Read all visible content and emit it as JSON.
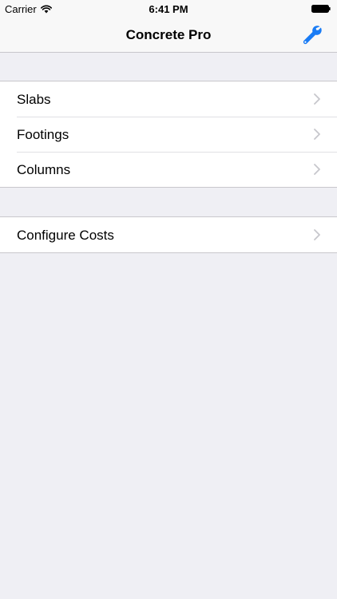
{
  "status_bar": {
    "carrier": "Carrier",
    "time": "6:41 PM",
    "wifi_icon": "wifi-icon",
    "battery_icon": "battery-icon"
  },
  "nav_bar": {
    "title": "Concrete Pro",
    "right_icon": "wrench-icon",
    "accent_color": "#1a7cf5"
  },
  "sections": [
    {
      "items": [
        {
          "label": "Slabs"
        },
        {
          "label": "Footings"
        },
        {
          "label": "Columns"
        }
      ]
    },
    {
      "items": [
        {
          "label": "Configure Costs"
        }
      ]
    }
  ],
  "colors": {
    "background": "#efeff4",
    "cell": "#ffffff",
    "separator": "#c8c7cc",
    "chevron": "#c7c7cc"
  }
}
